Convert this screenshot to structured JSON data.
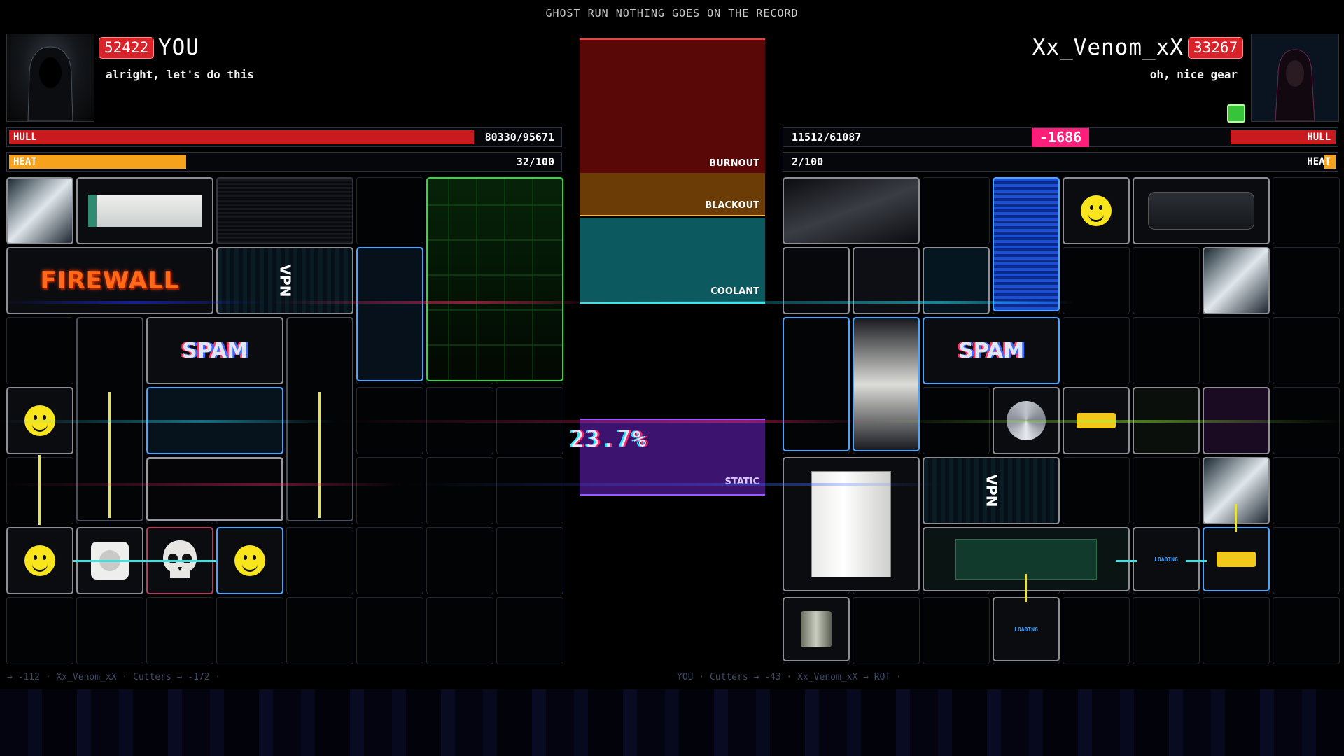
{
  "banner": "GHOST RUN   NOTHING GOES ON THE RECORD",
  "player": {
    "score": "52422",
    "name": "YOU",
    "quote": "alright, let's do this",
    "hull_label": "HULL",
    "hull_value": "80330/95671",
    "hull_fraction": 0.84,
    "heat_label": "HEAT",
    "heat_value": "32/100",
    "heat_fraction": 0.32,
    "items": {
      "firewall": "FIREWALL",
      "vpn": "VPN",
      "spam": "SPAM"
    }
  },
  "opponent": {
    "score": "33267",
    "name": "Xx_Venom_xX",
    "quote": "oh, nice gear",
    "hull_label": "HULL",
    "hull_value": "11512/61087",
    "hull_fraction": 0.19,
    "damage_popup": "-1686",
    "heat_label": "HEAT",
    "heat_value": "2/100",
    "heat_fraction": 0.02,
    "items": {
      "spam": "SPAM",
      "vpn": "VPN",
      "loading_1": "LOADING",
      "loading_2": "LOADING"
    }
  },
  "center_meter": {
    "burnout": "BURNOUT",
    "blackout": "BLACKOUT",
    "coolant": "COOLANT",
    "readout": "23.7%",
    "status": "STATIC"
  },
  "log": {
    "left": "→ -112   ·   Xx_Venom_xX · Cutters → -172   ·",
    "right": "YOU · Cutters → -43   ·   Xx_Venom_xX → ROT   ·"
  },
  "colors": {
    "hull": "#c81a1f",
    "heat": "#f6a21d",
    "burnout": "#5a0708",
    "blackout": "#6b3c05",
    "coolant": "#0c5a5f",
    "static": "#3c136e",
    "damage": "#ff1f7a"
  }
}
